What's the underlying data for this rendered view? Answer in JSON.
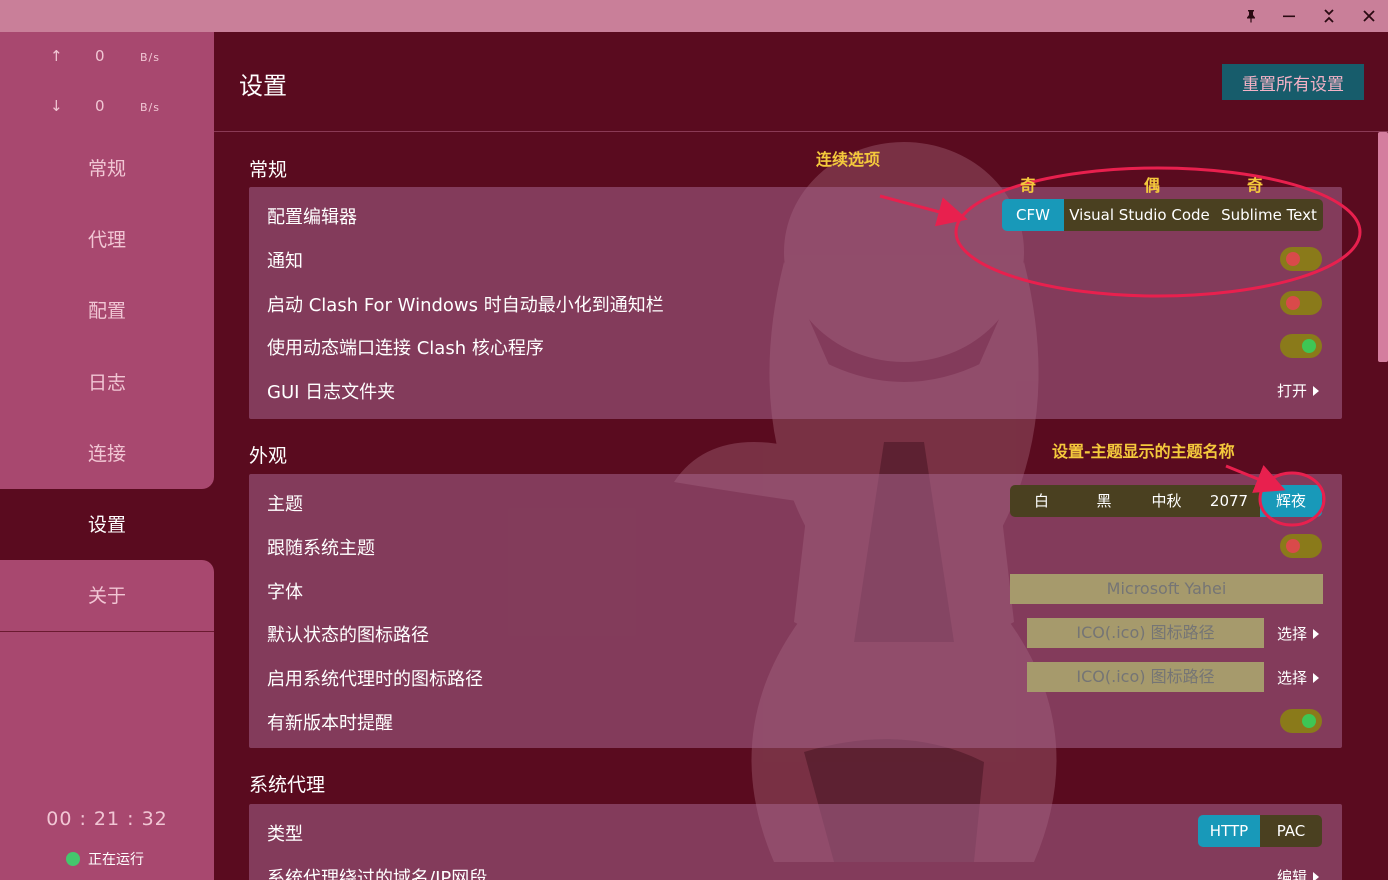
{
  "window": {
    "controls": [
      "pin-icon",
      "minimize-icon",
      "maximize-icon",
      "close-icon"
    ]
  },
  "sidebar": {
    "upload": {
      "arrow": "↑",
      "value": "0",
      "unit": "B/s"
    },
    "download": {
      "arrow": "↓",
      "value": "0",
      "unit": "B/s"
    },
    "items": [
      {
        "label": "常规"
      },
      {
        "label": "代理"
      },
      {
        "label": "配置"
      },
      {
        "label": "日志"
      },
      {
        "label": "连接"
      },
      {
        "label": "设置"
      },
      {
        "label": "关于"
      }
    ],
    "active_index": 5,
    "timer": "00 : 21 : 32",
    "status": "正在运行"
  },
  "header": {
    "title": "设置",
    "reset_label": "重置所有设置"
  },
  "sections": {
    "general": {
      "title": "常规",
      "editor_label": "配置编辑器",
      "editor_options": [
        "CFW",
        "Visual Studio Code",
        "Sublime Text"
      ],
      "editor_selected": "CFW",
      "notify_label": "通知",
      "notify_on": false,
      "minimize_label": "启动 Clash For Windows 时自动最小化到通知栏",
      "minimize_on": false,
      "dynamic_port_label": "使用动态端口连接 Clash 核心程序",
      "dynamic_port_on": true,
      "gui_log_label": "GUI 日志文件夹",
      "gui_log_action": "打开"
    },
    "appearance": {
      "title": "外观",
      "theme_label": "主题",
      "theme_options": [
        "白",
        "黑",
        "中秋",
        "2077",
        "辉夜"
      ],
      "theme_selected": "辉夜",
      "follow_system_label": "跟随系统主题",
      "follow_system_on": false,
      "font_label": "字体",
      "font_placeholder": "Microsoft Yahei",
      "default_icon_label": "默认状态的图标路径",
      "default_icon_placeholder": "ICO(.ico) 图标路径",
      "default_icon_action": "选择",
      "proxy_icon_label": "启用系统代理时的图标路径",
      "proxy_icon_placeholder": "ICO(.ico) 图标路径",
      "proxy_icon_action": "选择",
      "update_notify_label": "有新版本时提醒",
      "update_notify_on": true
    },
    "system_proxy": {
      "title": "系统代理",
      "type_label": "类型",
      "type_options": [
        "HTTP",
        "PAC"
      ],
      "type_selected": "HTTP",
      "bypass_label": "系统代理绕过的域名/IP网段",
      "bypass_action": "编辑"
    }
  },
  "annotations": {
    "continuous": "连续选项",
    "odd1": "奇",
    "even": "偶",
    "odd2": "奇",
    "theme_note": "设置-主题显示的主题名称",
    "color": "#e8204e"
  }
}
